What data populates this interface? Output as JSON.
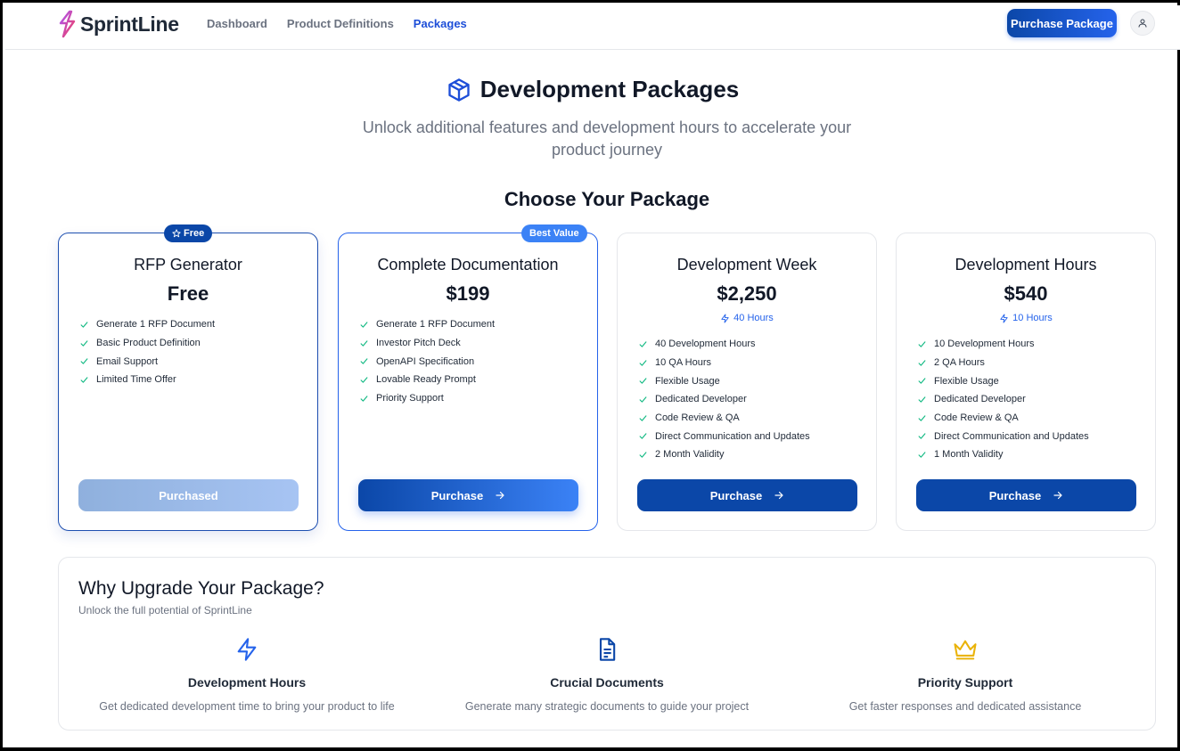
{
  "header": {
    "brand": "SprintLine",
    "nav": [
      {
        "label": "Dashboard"
      },
      {
        "label": "Product Definitions"
      },
      {
        "label": "Packages"
      }
    ],
    "active_nav": "Packages",
    "purchase_label": "Purchase Package",
    "user_icon": "user-icon"
  },
  "hero": {
    "icon": "package-icon",
    "title": "Development Packages",
    "subtitle": "Unlock additional features and development hours to accelerate your product journey"
  },
  "section_title": "Choose Your Package",
  "colors": {
    "primary": "#0b47a8",
    "accent": "#2563eb",
    "check": "#10b981",
    "crown": "#eab308"
  },
  "packages": [
    {
      "badge": "Free",
      "title": "RFP Generator",
      "price": "Free",
      "features": [
        "Generate 1 RFP Document",
        "Basic Product Definition",
        "Email Support",
        "Limited Time Offer"
      ],
      "button": "Purchased"
    },
    {
      "badge": "Best Value",
      "title": "Complete Documentation",
      "price": "$199",
      "features": [
        "Generate 1 RFP Document",
        "Investor Pitch Deck",
        "OpenAPI Specification",
        "Lovable Ready Prompt",
        "Priority Support"
      ],
      "button": "Purchase"
    },
    {
      "title": "Development Week",
      "price": "$2,250",
      "hours": "40 Hours",
      "features": [
        "40 Development Hours",
        "10 QA Hours",
        "Flexible Usage",
        "Dedicated Developer",
        "Code Review & QA",
        "Direct Communication and Updates",
        "2 Month Validity"
      ],
      "button": "Purchase"
    },
    {
      "title": "Development Hours",
      "price": "$540",
      "hours": "10 Hours",
      "features": [
        "10 Development Hours",
        "2 QA Hours",
        "Flexible Usage",
        "Dedicated Developer",
        "Code Review & QA",
        "Direct Communication and Updates",
        "1 Month Validity"
      ],
      "button": "Purchase"
    }
  ],
  "why": {
    "title": "Why Upgrade Your Package?",
    "subtitle": "Unlock the full potential of SprintLine",
    "benefits": [
      {
        "icon": "lightning-icon",
        "title": "Development Hours",
        "description": "Get dedicated development time to bring your product to life"
      },
      {
        "icon": "document-icon",
        "title": "Crucial Documents",
        "description": "Generate many strategic documents to guide your project"
      },
      {
        "icon": "crown-icon",
        "title": "Priority Support",
        "description": "Get faster responses and dedicated assistance"
      }
    ]
  }
}
